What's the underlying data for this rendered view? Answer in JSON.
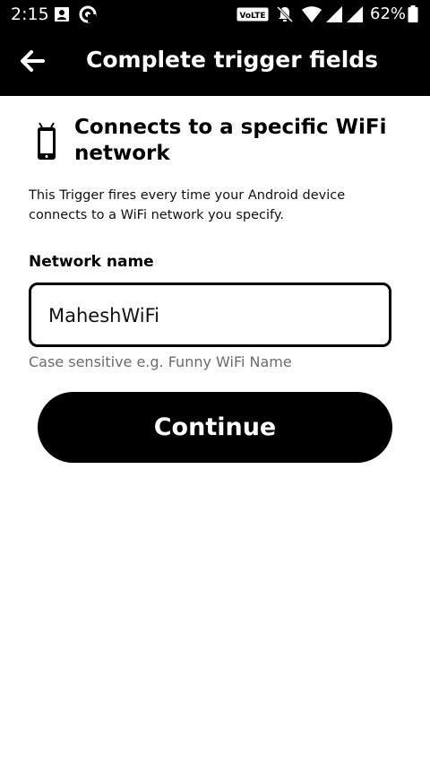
{
  "status_bar": {
    "time": "2:15",
    "volte_label": "VoLTE",
    "battery_percent": "62%",
    "icons": [
      "contact-card-icon",
      "at-sign-icon",
      "volte-icon",
      "notifications-off-icon",
      "wifi-icon",
      "signal-icon",
      "signal-icon",
      "battery-icon"
    ]
  },
  "app_bar": {
    "back_icon": "arrow-left-icon",
    "title": "Complete trigger fields"
  },
  "trigger": {
    "icon": "phone-icon",
    "title": "Connects to a specific WiFi network",
    "description": "This Trigger fires every time your Android device connects to a WiFi network you specify."
  },
  "form": {
    "field_label": "Network name",
    "field_value": "MaheshWiFi",
    "helper_text": "Case sensitive e.g. Funny WiFi Name",
    "continue_label": "Continue"
  },
  "colors": {
    "bar": "#000000",
    "background": "#ffffff",
    "helper_text": "#6b6b6b"
  }
}
